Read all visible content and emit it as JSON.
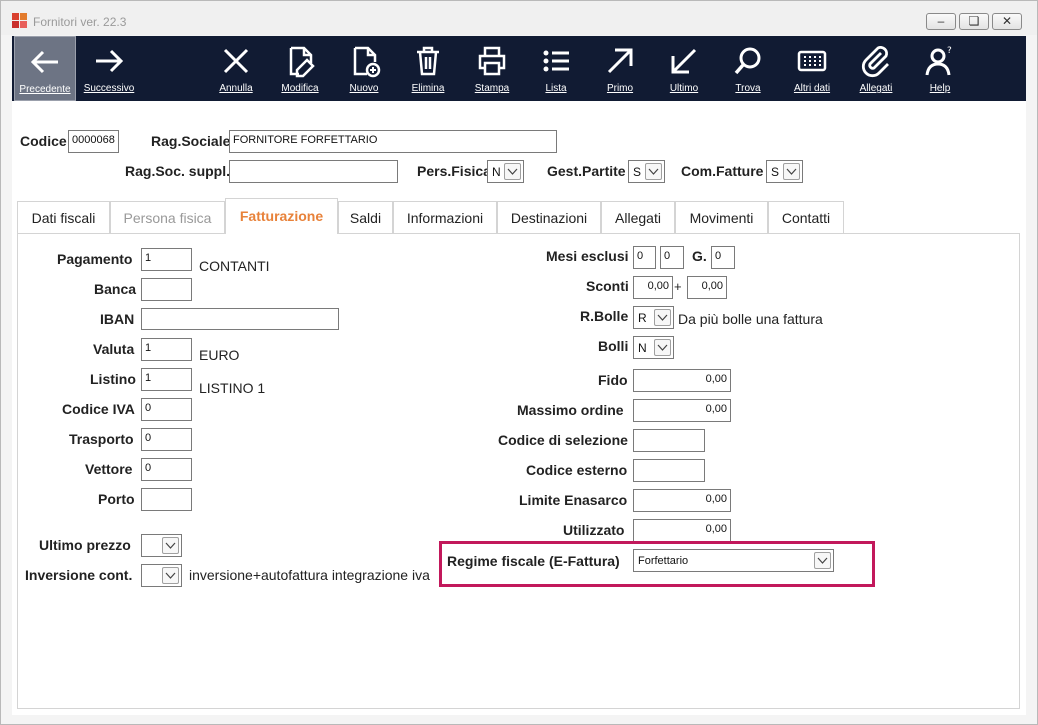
{
  "window": {
    "title": "Fornitori ver. 22.3"
  },
  "toolbar": [
    {
      "label": "Precedente",
      "icon": "arrow-left-icon",
      "active": true
    },
    {
      "label": "Successivo",
      "icon": "arrow-right-icon"
    },
    {
      "label": "Annulla",
      "icon": "close-icon"
    },
    {
      "label": "Modifica",
      "icon": "edit-document-icon"
    },
    {
      "label": "Nuovo",
      "icon": "new-document-icon"
    },
    {
      "label": "Elimina",
      "icon": "trash-icon"
    },
    {
      "label": "Stampa",
      "icon": "printer-icon"
    },
    {
      "label": "Lista",
      "icon": "list-icon"
    },
    {
      "label": "Primo",
      "icon": "arrow-up-right-icon"
    },
    {
      "label": "Ultimo",
      "icon": "arrow-down-left-icon"
    },
    {
      "label": "Trova",
      "icon": "search-icon"
    },
    {
      "label": "Altri dati",
      "icon": "grid-icon"
    },
    {
      "label": "Allegati",
      "icon": "paperclip-icon"
    },
    {
      "label": "Help",
      "icon": "help-user-icon"
    }
  ],
  "header": {
    "codice_label": "Codice",
    "codice_value": "0000068",
    "ragsoc_label": "Rag.Sociale",
    "ragsoc_value": "FORNITORE FORFETTARIO",
    "ragsoc_suppl_label": "Rag.Soc. suppl.",
    "ragsoc_suppl_value": "",
    "pers_fisica_label": "Pers.Fisica",
    "pers_fisica_value": "N",
    "gest_partite_label": "Gest.Partite",
    "gest_partite_value": "S",
    "com_fatture_label": "Com.Fatture",
    "com_fatture_value": "S"
  },
  "tabs": [
    {
      "label": "Dati fiscali"
    },
    {
      "label": "Persona fisica",
      "disabled": true
    },
    {
      "label": "Fatturazione",
      "active": true
    },
    {
      "label": "Saldi"
    },
    {
      "label": "Informazioni"
    },
    {
      "label": "Destinazioni"
    },
    {
      "label": "Allegati"
    },
    {
      "label": "Movimenti"
    },
    {
      "label": "Contatti"
    }
  ],
  "left": {
    "pagamento": {
      "label": "Pagamento",
      "value": "1",
      "desc": "CONTANTI"
    },
    "banca": {
      "label": "Banca",
      "value": ""
    },
    "iban": {
      "label": "IBAN",
      "value": ""
    },
    "valuta": {
      "label": "Valuta",
      "value": "1",
      "desc": "EURO"
    },
    "listino": {
      "label": "Listino",
      "value": "1",
      "desc": "LISTINO 1"
    },
    "codice_iva": {
      "label": "Codice IVA",
      "value": "0"
    },
    "trasporto": {
      "label": "Trasporto",
      "value": "0"
    },
    "vettore": {
      "label": "Vettore",
      "value": "0"
    },
    "porto": {
      "label": "Porto",
      "value": ""
    },
    "ultimo_prezzo": {
      "label": "Ultimo prezzo",
      "value": ""
    },
    "inversione": {
      "label": "Inversione cont.",
      "value": "",
      "desc": "inversione+autofattura integrazione iva"
    }
  },
  "right": {
    "mesi_esclusi": {
      "label": "Mesi esclusi",
      "v1": "0",
      "v2": "0",
      "g_label": "G.",
      "g_value": "0"
    },
    "sconti": {
      "label": "Sconti",
      "v1": "0,00",
      "plus": "+",
      "v2": "0,00"
    },
    "rbolle": {
      "label": "R.Bolle",
      "value": "R",
      "desc": "Da più bolle una fattura"
    },
    "bolli": {
      "label": "Bolli",
      "value": "N"
    },
    "fido": {
      "label": "Fido",
      "value": "0,00"
    },
    "massimo_ordine": {
      "label": "Massimo ordine",
      "value": "0,00"
    },
    "codice_selezione": {
      "label": "Codice di selezione",
      "value": ""
    },
    "codice_esterno": {
      "label": "Codice esterno",
      "value": ""
    },
    "limite_enasarco": {
      "label": "Limite Enasarco",
      "value": "0,00"
    },
    "utilizzato": {
      "label": "Utilizzato",
      "value": "0,00"
    },
    "regime_fiscale": {
      "label": "Regime fiscale (E-Fattura)",
      "value": "Forfettario"
    }
  },
  "colors": {
    "toolbar_bg": "#111b33",
    "active_tab": "#e8823a",
    "highlight": "#c2185b"
  }
}
